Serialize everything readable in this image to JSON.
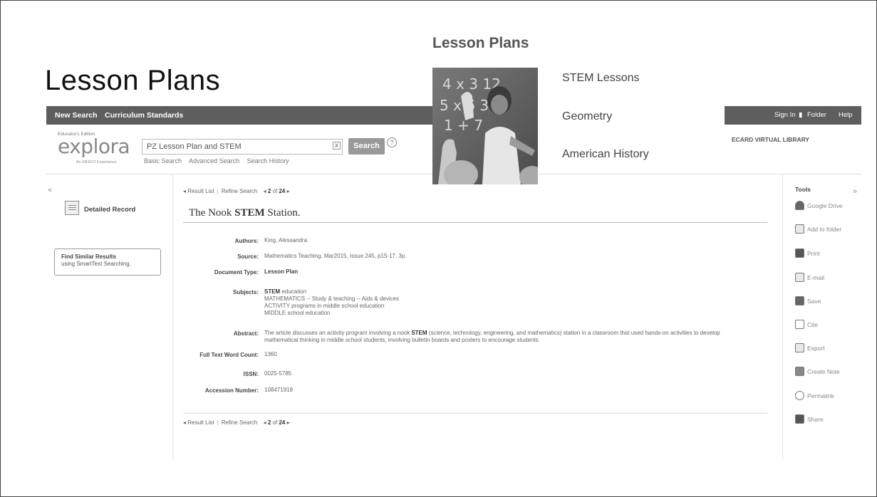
{
  "slide": {
    "title": "Lesson Plans",
    "overlay_title": "Lesson Plans",
    "topics": [
      "STEM Lessons",
      "Geometry",
      "American History"
    ],
    "photo": {
      "icon": "teacher-classroom-photo",
      "board_text": "4 x 3 12  5 x 6 30  1 + 7"
    }
  },
  "topbar": {
    "left": [
      "New Search",
      "Curriculum Standards"
    ],
    "sign_in": "Sign In",
    "folder": "Folder",
    "help": "Help"
  },
  "header": {
    "logo_edition": "Educator's Edition",
    "logo": "explora",
    "logo_sub": "An EBSCO Experience",
    "search_value": "PZ Lesson Plan and STEM",
    "search_button": "Search",
    "help_icon": "?",
    "clear_icon": "x",
    "links": [
      "Basic Search",
      "Advanced Search",
      "Search History"
    ],
    "library": "ECARD VIRTUAL LIBRARY"
  },
  "left_sidebar": {
    "collapse": "«",
    "detailed_record": "Detailed Record",
    "find_similar_title": "Find Similar Results",
    "find_similar_sub": "using SmartText Searching."
  },
  "result_nav": {
    "prefix": "◂",
    "result_list": "Result List",
    "refine_search": "Refine Search",
    "prev": "◂",
    "position": "2",
    "of_word": "of",
    "total": "24",
    "next": "▸"
  },
  "record": {
    "title_prefix": "The Nook ",
    "title_bold": "STEM",
    "title_suffix": " Station.",
    "authors_label": "Authors:",
    "authors": "King, Alessandra",
    "source_label": "Source:",
    "source": "Mathematics Teaching. Mar2015, Issue 245, p15-17. 3p.",
    "doctype_label": "Document Type:",
    "doctype": "Lesson Plan",
    "subjects_label": "Subjects:",
    "subject_1_bold": "STEM",
    "subject_1_rest": " education",
    "subject_2": "MATHEMATICS -- Study & teaching -- Aids & devices",
    "subject_3": "ACTIVITY programs in middle school education",
    "subject_4": "MIDDLE school education",
    "abstract_label": "Abstract:",
    "abstract_1a": "The article discusses an activity program involving a nook ",
    "abstract_1b": "STEM",
    "abstract_1c": " (science, technology, engineering, and mathematics) station in a classroom that used hands-on activities to develop",
    "abstract_2": "mathematical thinking in middle school students, involving bulletin boards and posters to encourage students.",
    "wordcount_label": "Full Text Word Count:",
    "wordcount": "1360",
    "issn_label": "ISSN:",
    "issn": "0025-5785",
    "accession_label": "Accession Number:",
    "accession": "108471918"
  },
  "tools": {
    "title": "Tools",
    "collapse": "»",
    "items": [
      "Google Drive",
      "Add to folder",
      "Print",
      "E-mail",
      "Save",
      "Cite",
      "Export",
      "Create Note",
      "Permalink",
      "Share"
    ]
  }
}
